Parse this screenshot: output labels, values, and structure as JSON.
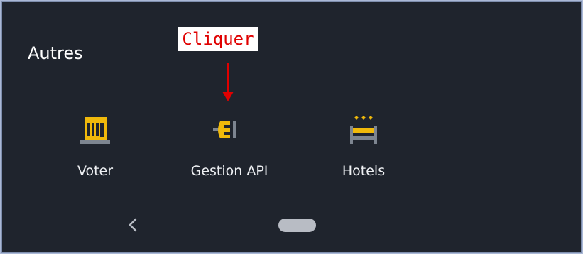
{
  "section": {
    "title": "Autres"
  },
  "callout": {
    "text": "Cliquer"
  },
  "tiles": [
    {
      "label": "Voter",
      "icon": "ballot-box-icon"
    },
    {
      "label": "Gestion API",
      "icon": "plug-icon"
    },
    {
      "label": "Hotels",
      "icon": "bed-icon"
    }
  ],
  "nav": {
    "back_icon": "chevron-left-icon",
    "home_icon": "home-pill-icon"
  },
  "colors": {
    "background": "#1f242d",
    "accent_yellow": "#f0b90b",
    "icon_gray": "#7d8590",
    "callout_red": "#e00000",
    "text": "#eef0f3"
  }
}
